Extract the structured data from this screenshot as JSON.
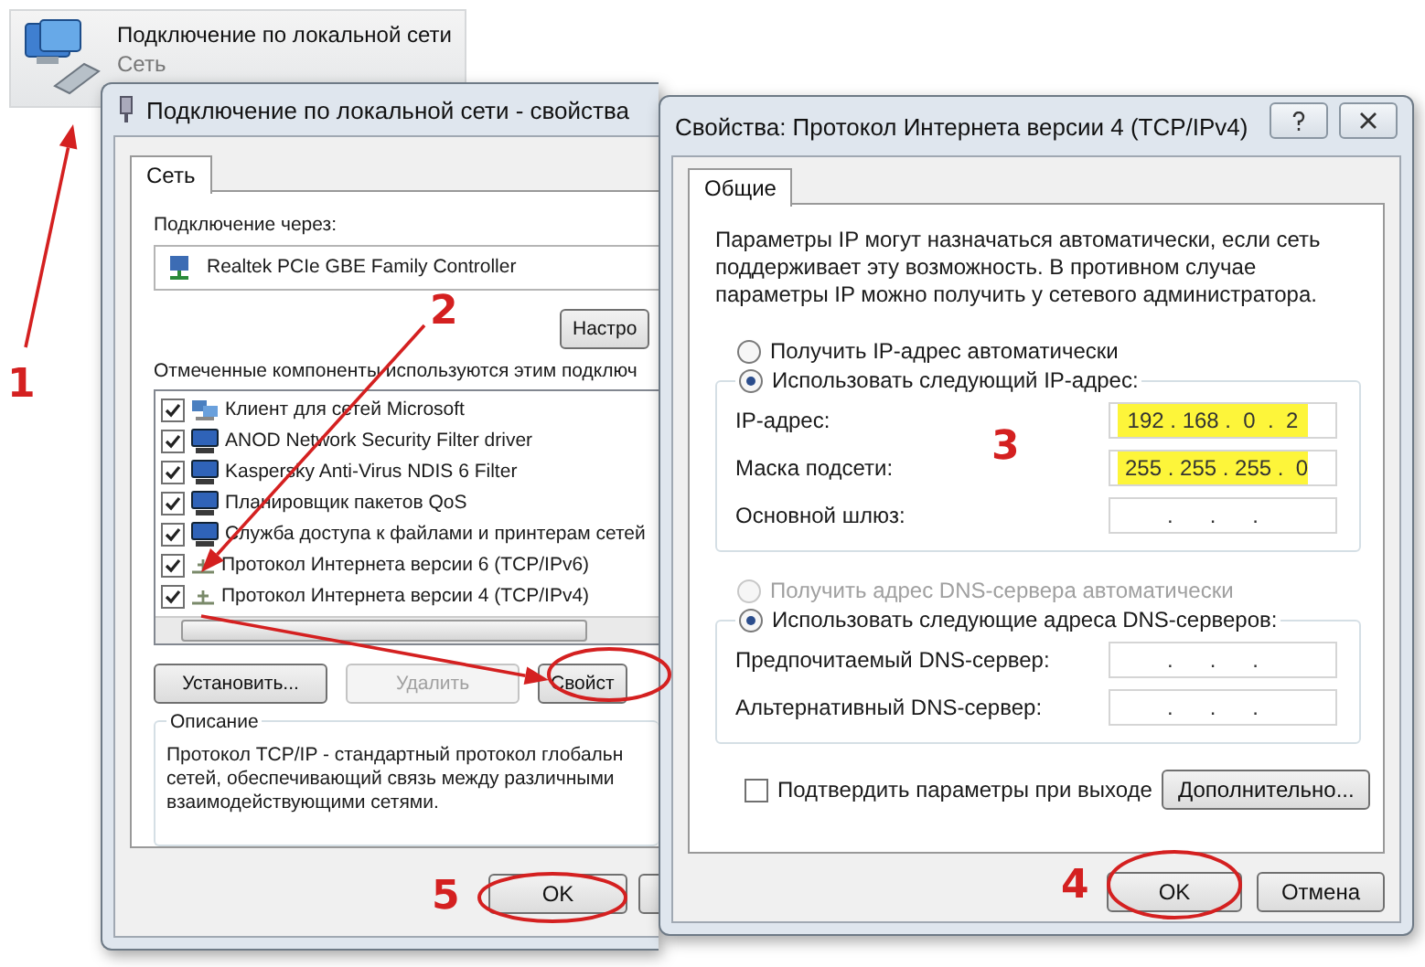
{
  "connection_item": {
    "title": "Подключение по локальной сети",
    "subtitle": "Сеть"
  },
  "properties_window": {
    "title": "Подключение по локальной сети - свойства",
    "tabs": [
      {
        "label": "Сеть",
        "selected": true
      }
    ],
    "connect_using_label": "Подключение через:",
    "adapter": "Realtek PCIe GBE Family Controller",
    "configure_button": "Настро",
    "components_label": "Отмеченные компоненты используются этим подключ",
    "components": [
      {
        "name": "Клиент для сетей Microsoft",
        "kind": "client",
        "checked": true
      },
      {
        "name": "ANOD Network Security Filter driver",
        "kind": "service",
        "checked": true
      },
      {
        "name": "Kaspersky Anti-Virus NDIS 6 Filter",
        "kind": "service",
        "checked": true
      },
      {
        "name": "Планировщик пакетов QoS",
        "kind": "service",
        "checked": true
      },
      {
        "name": "Служба доступа к файлами и принтерам сетей",
        "kind": "service",
        "checked": true
      },
      {
        "name": "Протокол Интернета версии 6 (TCP/IPv6)",
        "kind": "protocol",
        "checked": true
      },
      {
        "name": "Протокол Интернета версии 4 (TCP/IPv4)",
        "kind": "protocol",
        "checked": true
      }
    ],
    "buttons": [
      {
        "label": "Установить...",
        "disabled": false
      },
      {
        "label": "Удалить",
        "disabled": true
      },
      {
        "label": "Свойст",
        "disabled": false
      }
    ],
    "description": {
      "title": "Описание",
      "lines": [
        "Протокол TCP/IP - стандартный протокол глобальн",
        "сетей, обеспечивающий связь между различными",
        "взаимодействующими сетями."
      ]
    },
    "ok_button": "OK"
  },
  "ipv4_window": {
    "title": "Свойства: Протокол Интернета версии 4 (TCP/IPv4)",
    "tabs": [
      {
        "label": "Общие",
        "selected": true
      }
    ],
    "intro": "Параметры IP могут назначаться автоматически, если сеть поддерживает эту возможность. В противном случае параметры IP можно получить у сетевого администратора.",
    "ip_options": [
      {
        "label": "Получить IP-адрес автоматически",
        "selected": false,
        "disabled": false
      },
      {
        "label": "Использовать следующий IP-адрес:",
        "selected": true,
        "disabled": false
      }
    ],
    "address_fields": [
      {
        "label": "IP-адрес:",
        "value": "192 . 168 .  0  .  2",
        "highlighted": true
      },
      {
        "label": "Маска подсети:",
        "value": "255 . 255 . 255 .  0",
        "highlighted": true
      },
      {
        "label": "Основной шлюз:",
        "value": "   .      .      .   ",
        "highlighted": false
      }
    ],
    "dns_options": [
      {
        "label": "Получить адрес DNS-сервера автоматически",
        "selected": false,
        "disabled": true
      },
      {
        "label": "Использовать следующие адреса DNS-серверов:",
        "selected": true,
        "disabled": false
      }
    ],
    "dns_fields": [
      {
        "label": "Предпочитаемый DNS-сервер:",
        "value": "   .      .      .   ",
        "highlighted": false
      },
      {
        "label": "Альтернативный DNS-сервер:",
        "value": "   .      .      .   ",
        "highlighted": false
      }
    ],
    "validate_checkbox": {
      "label": "Подтвердить параметры при выходе",
      "checked": false
    },
    "advanced_button": "Дополнительно...",
    "ok_button": "OK",
    "cancel_button": "Отмена"
  },
  "annotations": {
    "step_numbers": [
      "1",
      "2",
      "3",
      "4",
      "5"
    ]
  }
}
